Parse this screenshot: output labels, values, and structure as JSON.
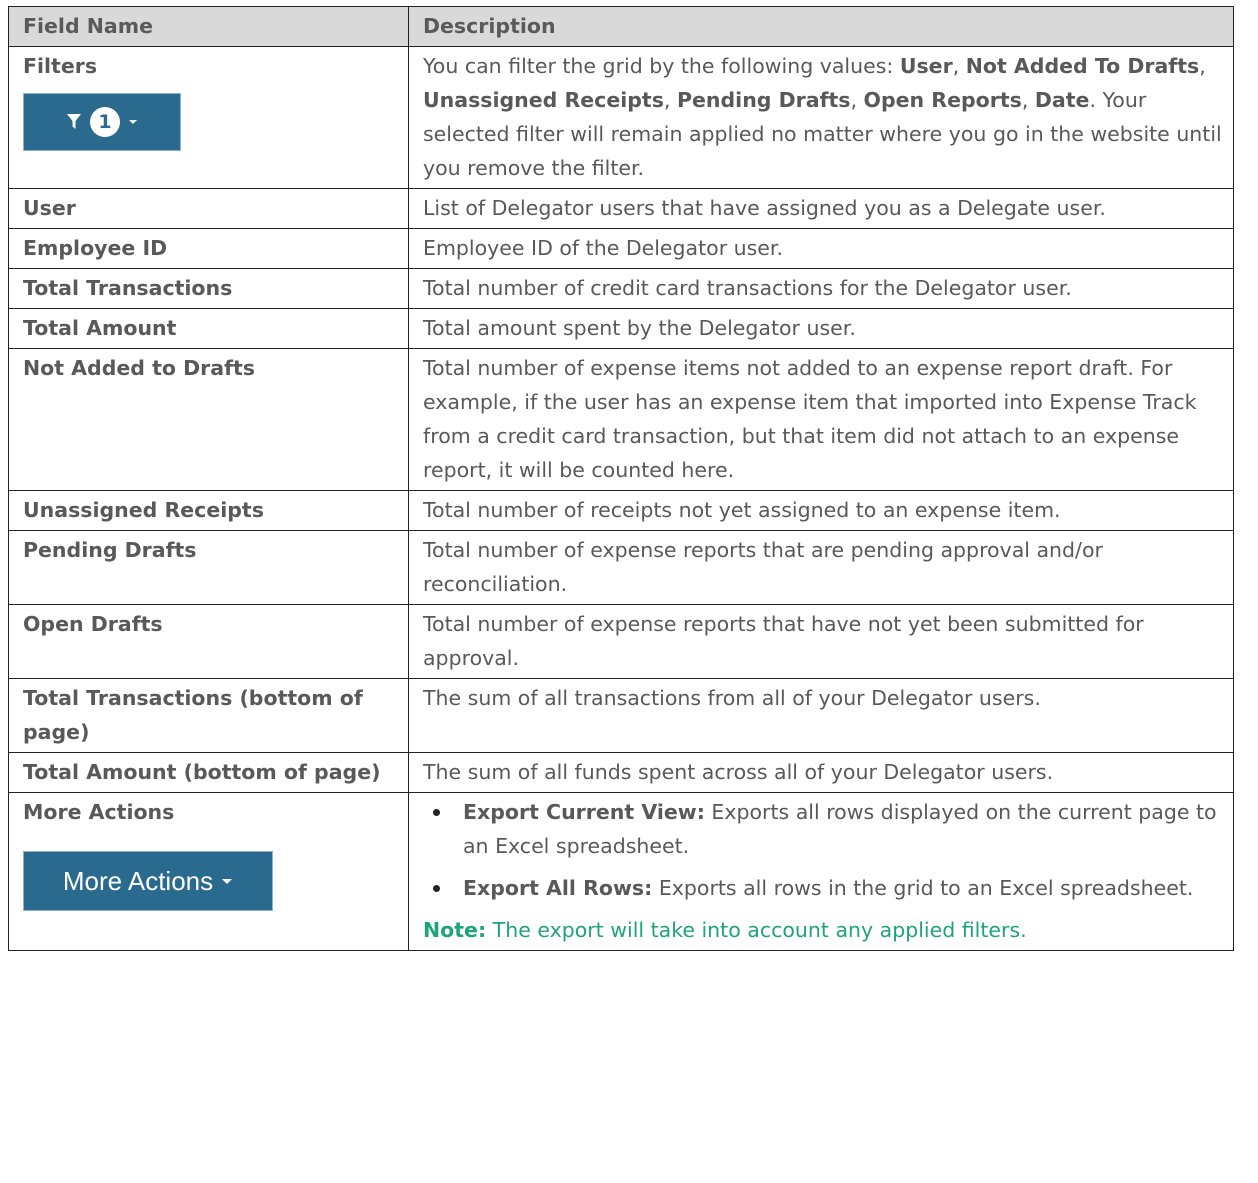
{
  "headers": {
    "field": "Field Name",
    "description": "Description"
  },
  "filters": {
    "name": "Filters",
    "badge_count": "1",
    "desc_intro": "You can filter the grid by the following values: ",
    "values": [
      "User",
      "Not Added To Drafts",
      "Unassigned Receipts",
      "Pending Drafts",
      "Open Reports",
      "Date"
    ],
    "desc_outro": ". Your selected filter will remain applied no matter where you go in the website until you remove the filter."
  },
  "rows": [
    {
      "name": "User",
      "desc": "List of Delegator users that have assigned you as a Delegate user."
    },
    {
      "name": "Employee ID",
      "desc": "Employee ID of the Delegator user."
    },
    {
      "name": "Total Transactions",
      "desc": "Total number of credit card transactions for the Delegator user."
    },
    {
      "name": "Total Amount",
      "desc": "Total amount spent by the Delegator user."
    },
    {
      "name": "Not Added to Drafts",
      "desc": "Total number of expense items not added to an expense report draft. For example, if the user has an expense item that imported into Expense Track from a credit card transaction, but that item did not attach to an expense report, it will be counted here."
    },
    {
      "name": "Unassigned Receipts",
      "desc": "Total number of receipts not yet assigned to an expense item."
    },
    {
      "name": "Pending Drafts",
      "desc": "Total number of expense reports that are pending approval and/or reconciliation."
    },
    {
      "name": "Open Drafts",
      "desc": "Total number of expense reports that have not yet been submitted for approval."
    },
    {
      "name": "Total Transactions (bottom of page)",
      "desc": "The sum of all transactions from all of your Delegator users."
    },
    {
      "name": "Total Amount (bottom of page)",
      "desc": "The sum of all funds spent across all of your Delegator users."
    }
  ],
  "more_actions": {
    "name": "More Actions",
    "button_label": "More Actions",
    "items": [
      {
        "title": "Export Current View:",
        "text": " Exports all rows displayed on the current page to an Excel spreadsheet."
      },
      {
        "title": "Export All Rows:",
        "text": " Exports all rows in the grid to an Excel spreadsheet."
      }
    ],
    "note_label": "Note:",
    "note_text": " The export will take into account any applied filters."
  },
  "colors": {
    "button": "#2b6a8f",
    "header_bg": "#d9d9d9",
    "note": "#1fa37a"
  }
}
